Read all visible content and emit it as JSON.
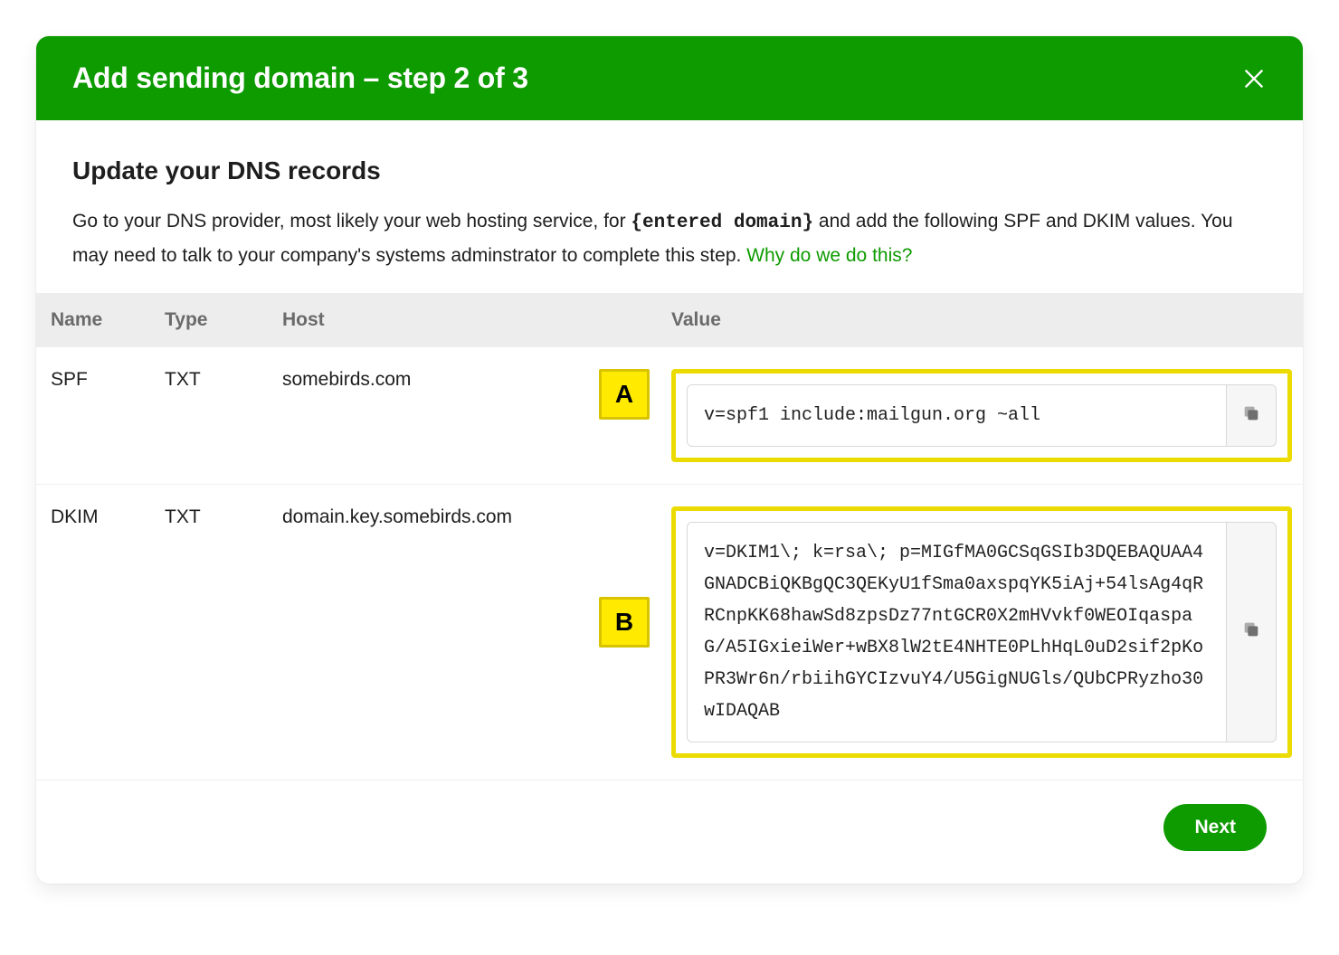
{
  "modal": {
    "title": "Add sending domain – step 2 of 3",
    "section_title": "Update your DNS records",
    "intro_pre": "Go to your DNS provider, most likely your web hosting service, for ",
    "entered_domain_token": "{entered domain}",
    "intro_post": " and add the following SPF and DKIM values. You may need to talk to your company's systems adminstrator to complete this step. ",
    "why_link": "Why do we do this?"
  },
  "table": {
    "headers": {
      "name": "Name",
      "type": "Type",
      "host": "Host",
      "value": "Value"
    },
    "rows": [
      {
        "name": "SPF",
        "type": "TXT",
        "host": "somebirds.com",
        "callout": "A",
        "value": "v=spf1 include:mailgun.org ~all"
      },
      {
        "name": "DKIM",
        "type": "TXT",
        "host": "domain.key.somebirds.com",
        "callout": "B",
        "value": "v=DKIM1\\; k=rsa\\; p=MIGfMA0GCSqGSIb3DQEBAQUAA4GNADCBiQKBgQC3QEKyU1fSma0axspqYK5iAj+54lsAg4qRRCnpKK68hawSd8zpsDz77ntGCR0X2mHVvkf0WEOIqaspaG/A5IGxieiWer+wBX8lW2tE4NHTE0PLhHqL0uD2sif2pKoPR3Wr6n/rbiihGYCIzvuY4/U5GigNUGls/QUbCPRyzho30wIDAQAB"
      }
    ]
  },
  "footer": {
    "next": "Next"
  }
}
